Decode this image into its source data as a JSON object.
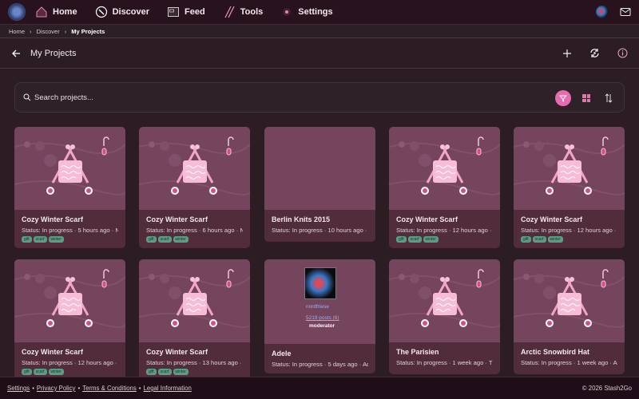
{
  "nav": {
    "items": [
      {
        "label": "Home"
      },
      {
        "label": "Discover"
      },
      {
        "label": "Feed"
      },
      {
        "label": "Tools"
      },
      {
        "label": "Settings"
      }
    ]
  },
  "breadcrumb": [
    "Home",
    "Discover",
    "My Projects"
  ],
  "page": {
    "title": "My Projects"
  },
  "search": {
    "placeholder": "Search projects..."
  },
  "colors": {
    "accent": "#e46db0",
    "card": "#512c3b",
    "tag": "#5b9c84"
  },
  "cards": [
    {
      "title": "Cozy Winter Scarf",
      "status": "Status: In progress · 5 hours ago · N",
      "tags": [
        "gift",
        "scarf",
        "winter"
      ],
      "image": "illustration"
    },
    {
      "title": "Cozy Winter Scarf",
      "status": "Status: In progress · 6 hours ago · N",
      "tags": [
        "gift",
        "scarf",
        "winter"
      ],
      "image": "illustration"
    },
    {
      "title": "Berlin Knits 2015",
      "status": "Status: In progress · 10 hours ago · #",
      "tags": [],
      "image": "photo"
    },
    {
      "title": "Cozy Winter Scarf",
      "status": "Status: In progress · 12 hours ago · N",
      "tags": [
        "gift",
        "scarf",
        "winter"
      ],
      "image": "illustration"
    },
    {
      "title": "Cozy Winter Scarf",
      "status": "Status: In progress · 12 hours ago · N",
      "tags": [
        "gift",
        "scarf",
        "winter"
      ],
      "image": "illustration"
    },
    {
      "title": "Cozy Winter Scarf",
      "status": "Status: In progress · 12 hours ago · N",
      "tags": [
        "gift",
        "scarf",
        "winter"
      ],
      "image": "illustration"
    },
    {
      "title": "Cozy Winter Scarf",
      "status": "Status: In progress · 13 hours ago · N",
      "tags": [
        "gift",
        "scarf",
        "winter"
      ],
      "image": "illustration"
    },
    {
      "title": "Adele",
      "status": "Status: In progress · 5 days ago · Ad",
      "tags": [],
      "image": "screen",
      "screen_text": {
        "user": "nordfriese",
        "posts": "5219 posts (6)",
        "role": "moderator"
      }
    },
    {
      "title": "The Parisien",
      "status": "Status: In progress · 1 week ago · Th",
      "tags": [],
      "image": "illustration"
    },
    {
      "title": "Arctic Snowbird Hat",
      "status": "Status: In progress · 1 week ago · Ar",
      "tags": [],
      "image": "illustration"
    }
  ],
  "footer": {
    "links": [
      "Settings",
      "Privacy Policy",
      "Terms & Conditions",
      "Legal Information"
    ],
    "copyright": "© 2026 Stash2Go"
  }
}
